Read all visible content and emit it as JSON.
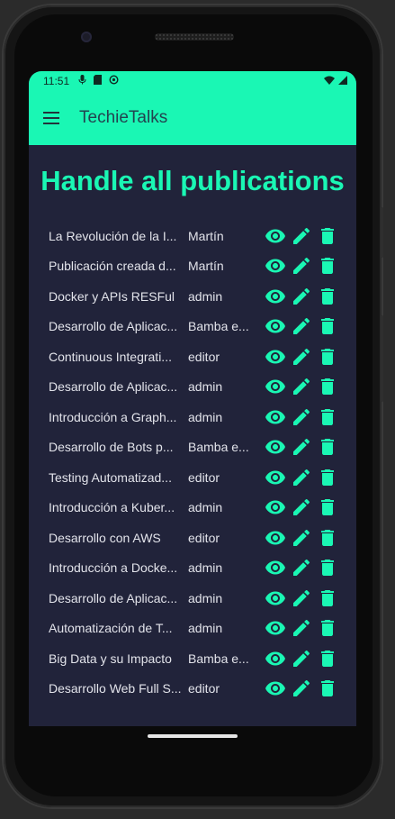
{
  "status": {
    "time": "11:51",
    "left_icons": [
      "mic-icon",
      "sd-card-icon",
      "sync-icon"
    ],
    "right_icons": [
      "wifi-icon",
      "signal-icon"
    ]
  },
  "app": {
    "title": "TechieTalks",
    "accent": "#1af7b4",
    "background": "#21233a"
  },
  "page": {
    "title": "Handle all publications"
  },
  "actions": [
    "eye-icon",
    "pencil-icon",
    "trash-icon"
  ],
  "publications": [
    {
      "title": "La Revolución de la I...",
      "author": "Martín"
    },
    {
      "title": "Publicación creada d...",
      "author": "Martín"
    },
    {
      "title": "Docker y APIs RESFul",
      "author": "admin"
    },
    {
      "title": "Desarrollo de Aplicac...",
      "author": "Bamba e..."
    },
    {
      "title": "Continuous Integrati...",
      "author": "editor"
    },
    {
      "title": "Desarrollo de Aplicac...",
      "author": "admin"
    },
    {
      "title": "Introducción a Graph...",
      "author": "admin"
    },
    {
      "title": "Desarrollo de Bots p...",
      "author": "Bamba e..."
    },
    {
      "title": "Testing Automatizad...",
      "author": "editor"
    },
    {
      "title": "Introducción a Kuber...",
      "author": "admin"
    },
    {
      "title": "Desarrollo con AWS",
      "author": "editor"
    },
    {
      "title": "Introducción a Docke...",
      "author": "admin"
    },
    {
      "title": "Desarrollo de Aplicac...",
      "author": "admin"
    },
    {
      "title": "Automatización de T...",
      "author": "admin"
    },
    {
      "title": "Big Data y su Impacto",
      "author": "Bamba e..."
    },
    {
      "title": "Desarrollo Web Full S...",
      "author": "editor"
    }
  ]
}
